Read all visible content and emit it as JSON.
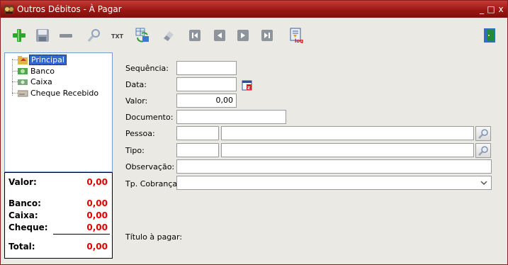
{
  "window": {
    "title": "Outros Débitos - À Pagar",
    "minimize": "_",
    "restore": "□",
    "close": "x"
  },
  "toolbar": {
    "buttons": [
      {
        "name": "add-icon",
        "label": "Adicionar"
      },
      {
        "name": "save-icon",
        "label": "Salvar"
      },
      {
        "name": "remove-icon",
        "label": "Remover"
      },
      {
        "name": "search-icon",
        "label": "Pesquisar"
      },
      {
        "name": "txt-export-icon",
        "label": "TXT"
      },
      {
        "name": "refresh-grid-icon",
        "label": "Atualizar"
      },
      {
        "name": "eraser-icon",
        "label": "Limpar"
      },
      {
        "name": "first-record-icon",
        "label": "Primeiro"
      },
      {
        "name": "prev-record-icon",
        "label": "Anterior"
      },
      {
        "name": "next-record-icon",
        "label": "Próximo"
      },
      {
        "name": "last-record-icon",
        "label": "Último"
      },
      {
        "name": "log-icon",
        "label": "Log"
      },
      {
        "name": "exit-door-icon",
        "label": "Sair"
      }
    ],
    "txt_text": "TXT",
    "log_text": "log"
  },
  "tree": {
    "items": [
      {
        "label": "Principal",
        "selected": true
      },
      {
        "label": "Banco",
        "selected": false
      },
      {
        "label": "Caixa",
        "selected": false
      },
      {
        "label": "Cheque Recebido",
        "selected": false
      }
    ]
  },
  "totals": {
    "valor_label": "Valor:",
    "valor": "0,00",
    "banco_label": "Banco:",
    "banco": "0,00",
    "caixa_label": "Caixa:",
    "caixa": "0,00",
    "cheque_label": "Cheque:",
    "cheque": "0,00",
    "total_label": "Total:",
    "total": "0,00"
  },
  "form": {
    "sequencia_label": "Sequência:",
    "sequencia": "",
    "data_label": "Data:",
    "data": "",
    "valor_label": "Valor:",
    "valor": "0,00",
    "documento_label": "Documento:",
    "documento": "",
    "pessoa_label": "Pessoa:",
    "pessoa_codigo": "",
    "pessoa_nome": "",
    "tipo_label": "Tipo:",
    "tipo_codigo": "",
    "tipo_nome": "",
    "observacao_label": "Observação:",
    "observacao": "",
    "tp_cobranca_label": "Tp. Cobrança:",
    "tp_cobranca": "",
    "titulo_label": "Título à pagar:"
  },
  "colors": {
    "titlebar": "#9b1712",
    "total_value": "#e00000",
    "selection": "#3366cc"
  }
}
